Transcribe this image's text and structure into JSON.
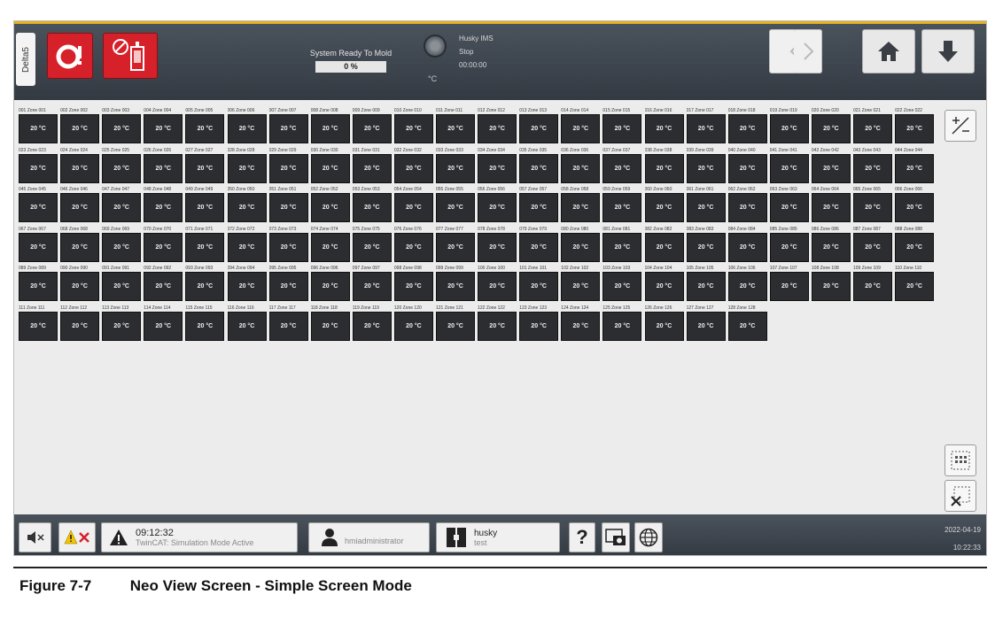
{
  "header": {
    "tab_label": "Delta5",
    "status_text": "System Ready To Mold",
    "progress_value": "0 %",
    "temp_unit": "°C",
    "machine_name": "Husky IMS",
    "machine_state": "Stop",
    "machine_timer": "00:00:00",
    "icons": [
      "alarm-icon",
      "heater-disabled-icon",
      "back-icon",
      "forward-icon",
      "home-icon",
      "download-icon"
    ]
  },
  "zones": [
    {
      "label": "001 Zone 001",
      "value": "20 °C"
    },
    {
      "label": "002 Zone 002",
      "value": "20 °C"
    },
    {
      "label": "003 Zone 003",
      "value": "20 °C"
    },
    {
      "label": "004 Zone 004",
      "value": "20 °C"
    },
    {
      "label": "005 Zone 005",
      "value": "20 °C"
    },
    {
      "label": "006 Zone 006",
      "value": "20 °C"
    },
    {
      "label": "007 Zone 007",
      "value": "20 °C"
    },
    {
      "label": "008 Zone 008",
      "value": "20 °C"
    },
    {
      "label": "009 Zone 009",
      "value": "20 °C"
    },
    {
      "label": "010 Zone 010",
      "value": "20 °C"
    },
    {
      "label": "011 Zone 011",
      "value": "20 °C"
    },
    {
      "label": "012 Zone 012",
      "value": "20 °C"
    },
    {
      "label": "013 Zone 013",
      "value": "20 °C"
    },
    {
      "label": "014 Zone 014",
      "value": "20 °C"
    },
    {
      "label": "015 Zone 015",
      "value": "20 °C"
    },
    {
      "label": "016 Zone 016",
      "value": "20 °C"
    },
    {
      "label": "017 Zone 017",
      "value": "20 °C"
    },
    {
      "label": "018 Zone 018",
      "value": "20 °C"
    },
    {
      "label": "019 Zone 019",
      "value": "20 °C"
    },
    {
      "label": "020 Zone 020",
      "value": "20 °C"
    },
    {
      "label": "021 Zone 021",
      "value": "20 °C"
    },
    {
      "label": "022 Zone 022",
      "value": "20 °C"
    },
    {
      "label": "023 Zone 023",
      "value": "20 °C"
    },
    {
      "label": "024 Zone 024",
      "value": "20 °C"
    },
    {
      "label": "025 Zone 025",
      "value": "20 °C"
    },
    {
      "label": "026 Zone 026",
      "value": "20 °C"
    },
    {
      "label": "027 Zone 027",
      "value": "20 °C"
    },
    {
      "label": "028 Zone 028",
      "value": "20 °C"
    },
    {
      "label": "029 Zone 029",
      "value": "20 °C"
    },
    {
      "label": "030 Zone 030",
      "value": "20 °C"
    },
    {
      "label": "031 Zone 031",
      "value": "20 °C"
    },
    {
      "label": "032 Zone 032",
      "value": "20 °C"
    },
    {
      "label": "033 Zone 033",
      "value": "20 °C"
    },
    {
      "label": "034 Zone 034",
      "value": "20 °C"
    },
    {
      "label": "035 Zone 035",
      "value": "20 °C"
    },
    {
      "label": "036 Zone 036",
      "value": "20 °C"
    },
    {
      "label": "037 Zone 037",
      "value": "20 °C"
    },
    {
      "label": "038 Zone 038",
      "value": "20 °C"
    },
    {
      "label": "039 Zone 039",
      "value": "20 °C"
    },
    {
      "label": "040 Zone 040",
      "value": "20 °C"
    },
    {
      "label": "041 Zone 041",
      "value": "20 °C"
    },
    {
      "label": "042 Zone 042",
      "value": "20 °C"
    },
    {
      "label": "043 Zone 043",
      "value": "20 °C"
    },
    {
      "label": "044 Zone 044",
      "value": "20 °C"
    },
    {
      "label": "045 Zone 045",
      "value": "20 °C"
    },
    {
      "label": "046 Zone 046",
      "value": "20 °C"
    },
    {
      "label": "047 Zone 047",
      "value": "20 °C"
    },
    {
      "label": "048 Zone 048",
      "value": "20 °C"
    },
    {
      "label": "049 Zone 049",
      "value": "20 °C"
    },
    {
      "label": "050 Zone 050",
      "value": "20 °C"
    },
    {
      "label": "051 Zone 051",
      "value": "20 °C"
    },
    {
      "label": "052 Zone 052",
      "value": "20 °C"
    },
    {
      "label": "053 Zone 053",
      "value": "20 °C"
    },
    {
      "label": "054 Zone 054",
      "value": "20 °C"
    },
    {
      "label": "055 Zone 055",
      "value": "20 °C"
    },
    {
      "label": "056 Zone 056",
      "value": "20 °C"
    },
    {
      "label": "057 Zone 057",
      "value": "20 °C"
    },
    {
      "label": "058 Zone 058",
      "value": "20 °C"
    },
    {
      "label": "059 Zone 059",
      "value": "20 °C"
    },
    {
      "label": "060 Zone 060",
      "value": "20 °C"
    },
    {
      "label": "061 Zone 061",
      "value": "20 °C"
    },
    {
      "label": "062 Zone 062",
      "value": "20 °C"
    },
    {
      "label": "063 Zone 063",
      "value": "20 °C"
    },
    {
      "label": "064 Zone 064",
      "value": "20 °C"
    },
    {
      "label": "065 Zone 065",
      "value": "20 °C"
    },
    {
      "label": "066 Zone 066",
      "value": "20 °C"
    },
    {
      "label": "067 Zone 067",
      "value": "20 °C"
    },
    {
      "label": "068 Zone 068",
      "value": "20 °C"
    },
    {
      "label": "069 Zone 069",
      "value": "20 °C"
    },
    {
      "label": "070 Zone 070",
      "value": "20 °C"
    },
    {
      "label": "071 Zone 071",
      "value": "20 °C"
    },
    {
      "label": "072 Zone 072",
      "value": "20 °C"
    },
    {
      "label": "073 Zone 073",
      "value": "20 °C"
    },
    {
      "label": "074 Zone 074",
      "value": "20 °C"
    },
    {
      "label": "075 Zone 075",
      "value": "20 °C"
    },
    {
      "label": "076 Zone 076",
      "value": "20 °C"
    },
    {
      "label": "077 Zone 077",
      "value": "20 °C"
    },
    {
      "label": "078 Zone 078",
      "value": "20 °C"
    },
    {
      "label": "079 Zone 079",
      "value": "20 °C"
    },
    {
      "label": "080 Zone 080",
      "value": "20 °C"
    },
    {
      "label": "081 Zone 081",
      "value": "20 °C"
    },
    {
      "label": "082 Zone 082",
      "value": "20 °C"
    },
    {
      "label": "083 Zone 083",
      "value": "20 °C"
    },
    {
      "label": "084 Zone 084",
      "value": "20 °C"
    },
    {
      "label": "085 Zone 085",
      "value": "20 °C"
    },
    {
      "label": "086 Zone 086",
      "value": "20 °C"
    },
    {
      "label": "087 Zone 087",
      "value": "20 °C"
    },
    {
      "label": "088 Zone 088",
      "value": "20 °C"
    },
    {
      "label": "089 Zone 089",
      "value": "20 °C"
    },
    {
      "label": "090 Zone 090",
      "value": "20 °C"
    },
    {
      "label": "091 Zone 091",
      "value": "20 °C"
    },
    {
      "label": "092 Zone 092",
      "value": "20 °C"
    },
    {
      "label": "093 Zone 093",
      "value": "20 °C"
    },
    {
      "label": "094 Zone 094",
      "value": "20 °C"
    },
    {
      "label": "095 Zone 095",
      "value": "20 °C"
    },
    {
      "label": "096 Zone 096",
      "value": "20 °C"
    },
    {
      "label": "097 Zone 097",
      "value": "20 °C"
    },
    {
      "label": "098 Zone 098",
      "value": "20 °C"
    },
    {
      "label": "099 Zone 099",
      "value": "20 °C"
    },
    {
      "label": "100 Zone 100",
      "value": "20 °C"
    },
    {
      "label": "101 Zone 101",
      "value": "20 °C"
    },
    {
      "label": "102 Zone 102",
      "value": "20 °C"
    },
    {
      "label": "103 Zone 103",
      "value": "20 °C"
    },
    {
      "label": "104 Zone 104",
      "value": "20 °C"
    },
    {
      "label": "105 Zone 105",
      "value": "20 °C"
    },
    {
      "label": "106 Zone 106",
      "value": "20 °C"
    },
    {
      "label": "107 Zone 107",
      "value": "20 °C"
    },
    {
      "label": "108 Zone 108",
      "value": "20 °C"
    },
    {
      "label": "109 Zone 109",
      "value": "20 °C"
    },
    {
      "label": "110 Zone 110",
      "value": "20 °C"
    },
    {
      "label": "111 Zone 111",
      "value": "20 °C"
    },
    {
      "label": "112 Zone 112",
      "value": "20 °C"
    },
    {
      "label": "113 Zone 113",
      "value": "20 °C"
    },
    {
      "label": "114 Zone 114",
      "value": "20 °C"
    },
    {
      "label": "115 Zone 115",
      "value": "20 °C"
    },
    {
      "label": "116 Zone 116",
      "value": "20 °C"
    },
    {
      "label": "117 Zone 117",
      "value": "20 °C"
    },
    {
      "label": "118 Zone 118",
      "value": "20 °C"
    },
    {
      "label": "119 Zone 119",
      "value": "20 °C"
    },
    {
      "label": "120 Zone 120",
      "value": "20 °C"
    },
    {
      "label": "121 Zone 121",
      "value": "20 °C"
    },
    {
      "label": "122 Zone 122",
      "value": "20 °C"
    },
    {
      "label": "123 Zone 123",
      "value": "20 °C"
    },
    {
      "label": "124 Zone 124",
      "value": "20 °C"
    },
    {
      "label": "125 Zone 125",
      "value": "20 °C"
    },
    {
      "label": "126 Zone 126",
      "value": "20 °C"
    },
    {
      "label": "127 Zone 127",
      "value": "20 °C"
    },
    {
      "label": "128 Zone 128",
      "value": "20 °C"
    }
  ],
  "footer": {
    "alarm_time": "09:12:32",
    "alarm_message": "TwinCAT: Simulation Mode Active",
    "user": "hmiadministrator",
    "mold_name": "husky",
    "mold_sub": "test",
    "date": "2022-04-19",
    "time": "10:22:33",
    "help_symbol": "?"
  },
  "caption": {
    "number": "Figure 7-7",
    "title": "Neo View Screen - Simple Screen Mode"
  }
}
